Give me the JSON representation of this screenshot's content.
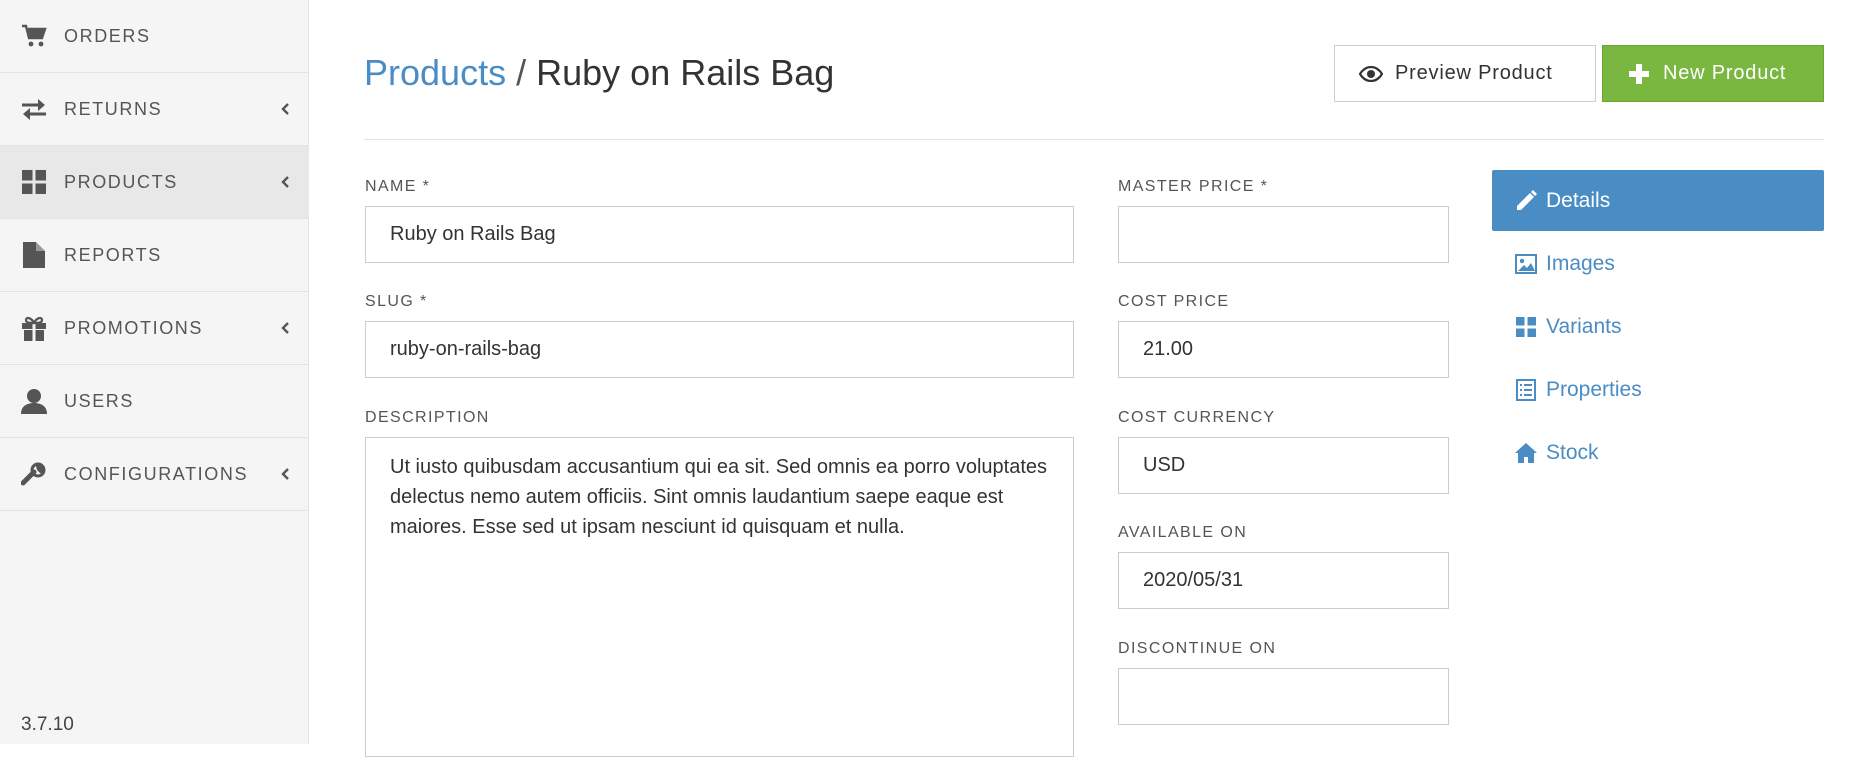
{
  "sidebar": {
    "items": [
      {
        "label": "ORDERS",
        "icon": "cart-icon",
        "chevron": false,
        "active": false
      },
      {
        "label": "RETURNS",
        "icon": "exchange-icon",
        "chevron": true,
        "active": false
      },
      {
        "label": "PRODUCTS",
        "icon": "grid-icon",
        "chevron": true,
        "active": true
      },
      {
        "label": "REPORTS",
        "icon": "file-icon",
        "chevron": false,
        "active": false
      },
      {
        "label": "PROMOTIONS",
        "icon": "gift-icon",
        "chevron": true,
        "active": false
      },
      {
        "label": "USERS",
        "icon": "user-icon",
        "chevron": false,
        "active": false
      },
      {
        "label": "CONFIGURATIONS",
        "icon": "wrench-icon",
        "chevron": true,
        "active": false
      }
    ],
    "version": "3.7.10"
  },
  "header": {
    "breadcrumb_link": "Products",
    "separator": "/",
    "title": "Ruby on Rails Bag",
    "preview_button": "Preview Product",
    "new_button": "New Product"
  },
  "form": {
    "name": {
      "label": "NAME *",
      "value": "Ruby on Rails Bag"
    },
    "slug": {
      "label": "SLUG *",
      "value": "ruby-on-rails-bag"
    },
    "description": {
      "label": "DESCRIPTION",
      "value": "Ut iusto quibusdam accusantium qui ea sit. Sed omnis ea porro voluptates delectus nemo autem officiis. Sint omnis laudantium saepe eaque est maiores. Esse sed ut ipsam nesciunt id quisquam et nulla."
    },
    "master_price": {
      "label": "MASTER PRICE *",
      "value": ""
    },
    "cost_price": {
      "label": "COST PRICE",
      "value": "21.00"
    },
    "cost_currency": {
      "label": "COST CURRENCY",
      "value": "USD"
    },
    "available_on": {
      "label": "AVAILABLE ON",
      "value": "2020/05/31"
    },
    "discontinue_on": {
      "label": "DISCONTINUE ON",
      "value": ""
    }
  },
  "tabs": [
    {
      "label": "Details",
      "icon": "pencil-icon",
      "active": true
    },
    {
      "label": "Images",
      "icon": "image-icon",
      "active": false
    },
    {
      "label": "Variants",
      "icon": "grid-icon",
      "active": false
    },
    {
      "label": "Properties",
      "icon": "list-icon",
      "active": false
    },
    {
      "label": "Stock",
      "icon": "home-icon",
      "active": false
    }
  ],
  "colors": {
    "link": "#4a8cc4",
    "primary_tab": "#4a8cc4",
    "success_button": "#7ab740",
    "sidebar_bg": "#f5f5f5"
  }
}
